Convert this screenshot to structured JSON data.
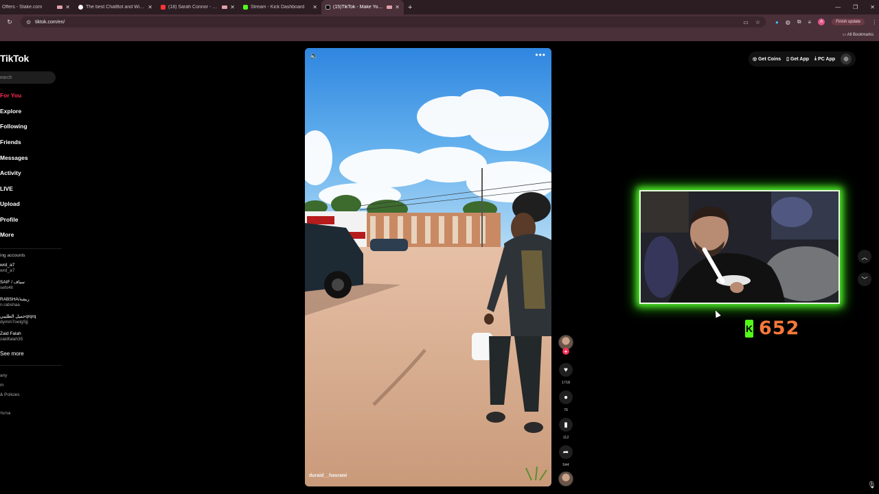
{
  "browser": {
    "tabs": [
      {
        "title": "Offers - Stake.com",
        "active": false,
        "color": "#2f6fd6"
      },
      {
        "title": "The best ChatBot and Widgets",
        "active": false,
        "color": "#ffffff"
      },
      {
        "title": "(18) Sarah Connor - From S",
        "active": false,
        "color": "#ff3333"
      },
      {
        "title": "Stream - Kick Dashboard",
        "active": false,
        "color": "#53fc18"
      },
      {
        "title": "(15)TikTok - Make Your Day",
        "active": true,
        "color": "#000000"
      }
    ],
    "new_tab": "+",
    "url": "tiktok.com/en/",
    "finish_update": "Finish update",
    "profile_initial": "A",
    "all_bookmarks": "All Bookmarks"
  },
  "sidebar": {
    "logo": "TikTok",
    "search_placeholder": "earch",
    "nav": [
      {
        "label": "For You",
        "active": true
      },
      {
        "label": "Explore",
        "active": false
      },
      {
        "label": "Following",
        "active": false
      },
      {
        "label": "Friends",
        "active": false
      },
      {
        "label": "Messages",
        "active": false
      },
      {
        "label": "Activity",
        "active": false
      },
      {
        "label": "LIVE",
        "active": false
      },
      {
        "label": "Upload",
        "active": false
      },
      {
        "label": "Profile",
        "active": false
      },
      {
        "label": "More",
        "active": false
      }
    ],
    "following_title": "ing accounts",
    "accounts": [
      {
        "name": "wrd_a7",
        "handle": "wrd_a7"
      },
      {
        "name": "SAIF / سياف",
        "handle": "sefo4ll"
      },
      {
        "name": "RABSHA/ربشة",
        "handle": "n.rabshaa"
      },
      {
        "name": "جميل الطليبيqrqrq",
        "handle": "dymm7oelgSjj"
      },
      {
        "name": "Zaid Falah",
        "handle": "zaidfalah35"
      }
    ],
    "see_more": "See more",
    "footer": [
      "any",
      "m",
      "& Policies",
      "TikTok"
    ]
  },
  "video": {
    "username": "duraid__hasrawi",
    "likes": "1718",
    "comments": "76",
    "saves": "112",
    "shares": "544"
  },
  "header": {
    "get_coins": "Get Coins",
    "get_app": "Get App",
    "pc_app": "PC App"
  },
  "overlay": {
    "viewer_count": "652",
    "kick_color": "#53fc18",
    "count_color": "#f7783a"
  }
}
